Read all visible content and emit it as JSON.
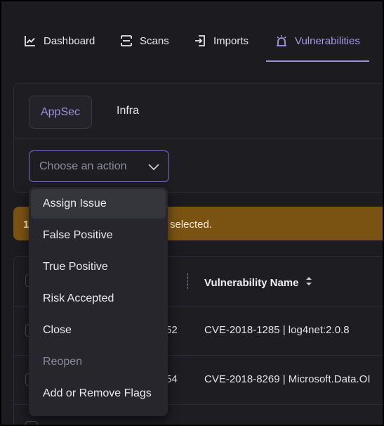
{
  "nav": {
    "items": [
      {
        "label": "Dashboard",
        "icon": "chart-line-icon",
        "active": false
      },
      {
        "label": "Scans",
        "icon": "scan-icon",
        "active": false
      },
      {
        "label": "Imports",
        "icon": "import-icon",
        "active": false
      },
      {
        "label": "Vulnerabilities",
        "icon": "siren-icon",
        "active": true
      }
    ],
    "active_color": "#a79ae6"
  },
  "tabs": {
    "appsec": "AppSec",
    "infra": "Infra"
  },
  "action_select": {
    "placeholder": "Choose an action"
  },
  "action_menu": {
    "items": [
      {
        "label": "Assign Issue",
        "state": "hover"
      },
      {
        "label": "False Positive",
        "state": "normal"
      },
      {
        "label": "True Positive",
        "state": "normal"
      },
      {
        "label": "Risk Accepted",
        "state": "normal"
      },
      {
        "label": "Close",
        "state": "normal"
      },
      {
        "label": "Reopen",
        "state": "disabled"
      },
      {
        "label": "Add or Remove Flags",
        "state": "normal"
      }
    ]
  },
  "banner": {
    "lead": "1",
    "text": "selected.",
    "color": "#7a5313"
  },
  "table": {
    "header": {
      "name_label": "Vulnerability Name"
    },
    "rows": [
      {
        "id_fragment": "52",
        "name": "CVE-2018-1285 | log4net:2.0.8"
      },
      {
        "id_fragment": "54",
        "name": "CVE-2018-8269 | Microsoft.Data.OI"
      }
    ]
  }
}
